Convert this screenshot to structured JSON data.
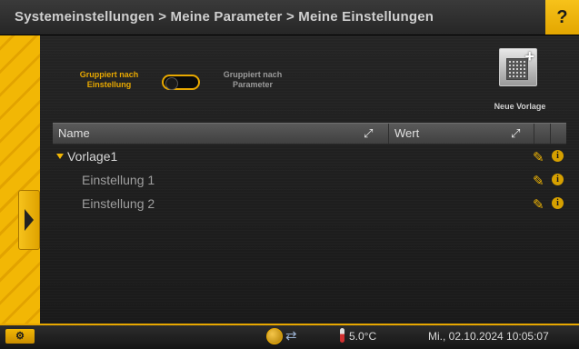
{
  "header": {
    "breadcrumb": "Systemeinstellungen > Meine Parameter > Meine Einstellungen",
    "help_label": "?"
  },
  "grouping": {
    "left_label_line1": "Gruppiert nach",
    "left_label_line2": "Einstellung",
    "right_label_line1": "Gruppiert nach",
    "right_label_line2": "Parameter",
    "selected": "Gruppiert nach Einstellung"
  },
  "new_template": {
    "label": "Neue Vorlage",
    "icon": "template-add-icon"
  },
  "table": {
    "columns": [
      "Name",
      "Wert"
    ],
    "rows": [
      {
        "label": "Vorlage1",
        "level": 0,
        "expanded": true
      },
      {
        "label": "Einstellung 1",
        "level": 1
      },
      {
        "label": "Einstellung 2",
        "level": 1
      }
    ]
  },
  "status": {
    "temperature": "5.0°C",
    "datetime": "Mi., 02.10.2024 10:05:07"
  },
  "colors": {
    "accent": "#f2b705",
    "background": "#1c1c1c",
    "header": "#4a4a4a"
  }
}
